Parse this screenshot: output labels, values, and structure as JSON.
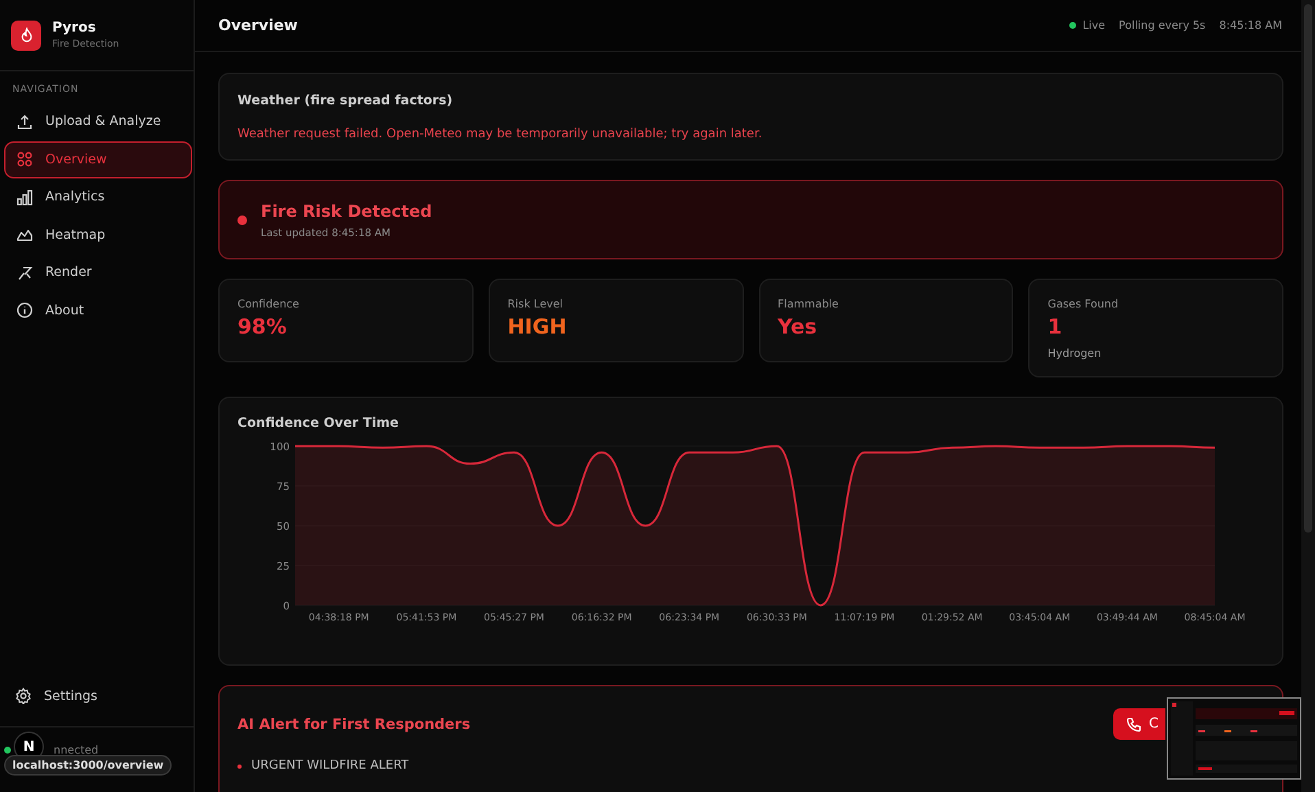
{
  "brand": {
    "name": "Pyros",
    "subtitle": "Fire Detection"
  },
  "sidebar": {
    "section_label": "NAVIGATION",
    "items": [
      {
        "label": "Upload & Analyze",
        "selected": false
      },
      {
        "label": "Overview",
        "selected": true
      },
      {
        "label": "Analytics",
        "selected": false
      },
      {
        "label": "Heatmap",
        "selected": false
      },
      {
        "label": "Render",
        "selected": false
      },
      {
        "label": "About",
        "selected": false
      }
    ],
    "settings": "Settings",
    "connection": {
      "text": "nnected",
      "connected": true
    }
  },
  "header": {
    "title": "Overview",
    "live": {
      "label": "Live",
      "on": true
    },
    "polling": "Polling every 5s",
    "time": "8:45:18 AM"
  },
  "weather": {
    "title": "Weather (fire spread factors)",
    "error": "Weather request failed. Open-Meteo may be temporarily unavailable; try again later."
  },
  "risk_banner": {
    "title": "Fire Risk Detected",
    "detected": true,
    "updated": "Last updated 8:45:18 AM"
  },
  "stats": [
    {
      "label": "Confidence",
      "value": "98%",
      "color": "#e8313d"
    },
    {
      "label": "Risk Level",
      "value": "HIGH",
      "color": "#f0641e"
    },
    {
      "label": "Flammable",
      "value": "Yes",
      "color": "#e8313d"
    },
    {
      "label": "Gases Found",
      "value": "1",
      "color": "#e8313d",
      "detail": "Hydrogen"
    }
  ],
  "chart": {
    "title": "Confidence Over Time",
    "chart_data": {
      "type": "area",
      "categories": [
        null,
        "04:38:18 PM",
        null,
        "05:41:53 PM",
        null,
        "05:45:27 PM",
        null,
        "06:16:32 PM",
        null,
        "06:23:34 PM",
        null,
        "06:30:33 PM",
        null,
        "11:07:19 PM",
        null,
        "01:29:52 AM",
        null,
        "03:45:04 AM",
        null,
        "03:49:44 AM",
        null,
        "08:45:04 AM"
      ],
      "series": [
        {
          "color": "#d8283a",
          "values": [
            100,
            100,
            99,
            100,
            89,
            96,
            50,
            96,
            50,
            96,
            96,
            100,
            0,
            96,
            96,
            99,
            100,
            99,
            99,
            100,
            100,
            99
          ]
        }
      ],
      "ylim": [
        0,
        100
      ],
      "yticks": [
        0,
        25,
        50,
        75,
        100
      ],
      "grid": true
    }
  },
  "alert": {
    "title": "AI Alert for First Responders",
    "button": "C",
    "bullets": [
      "URGENT WILDFIRE ALERT"
    ]
  },
  "overlay": {
    "badge": "N",
    "url": "localhost:3000/overview"
  }
}
